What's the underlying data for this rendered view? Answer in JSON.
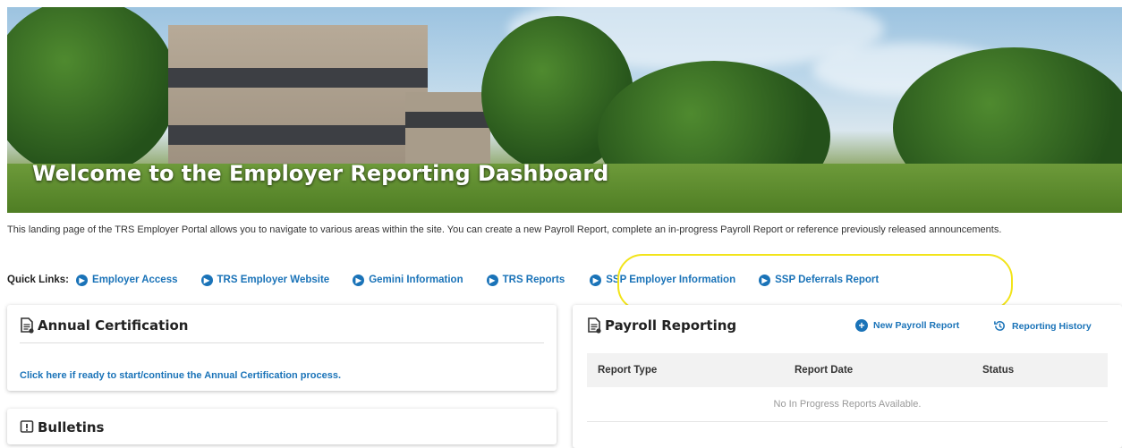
{
  "hero": {
    "title": "Welcome to the Employer Reporting Dashboard"
  },
  "intro": {
    "text": "This landing page of the TRS Employer Portal allows you to navigate to various areas within the site. You can create a new Payroll Report, complete an in-progress Payroll Report or reference previously released announcements."
  },
  "quick_links": {
    "label": "Quick Links:",
    "items": [
      {
        "label": "Employer Access"
      },
      {
        "label": "TRS Employer Website"
      },
      {
        "label": "Gemini Information"
      },
      {
        "label": "TRS Reports"
      },
      {
        "label": "SSP Employer Information"
      },
      {
        "label": "SSP Deferrals Report"
      }
    ]
  },
  "annual_certification": {
    "title": "Annual Certification",
    "link": "Click here if ready to start/continue the Annual Certification process."
  },
  "bulletins": {
    "title": "Bulletins"
  },
  "payroll": {
    "title": "Payroll Reporting",
    "new_report": "New Payroll Report",
    "history": "Reporting History",
    "columns": [
      "Report Type",
      "Report Date",
      "Status"
    ],
    "empty_message": "No In Progress Reports Available."
  },
  "colors": {
    "link": "#1a73b8",
    "highlight": "#f2e41a"
  },
  "icons": {
    "quick_link": "chevron-right-circle-icon",
    "card_header": "document-icon",
    "bulletins": "exclamation-box-icon",
    "new_report": "plus-circle-icon",
    "history": "history-clock-icon"
  }
}
